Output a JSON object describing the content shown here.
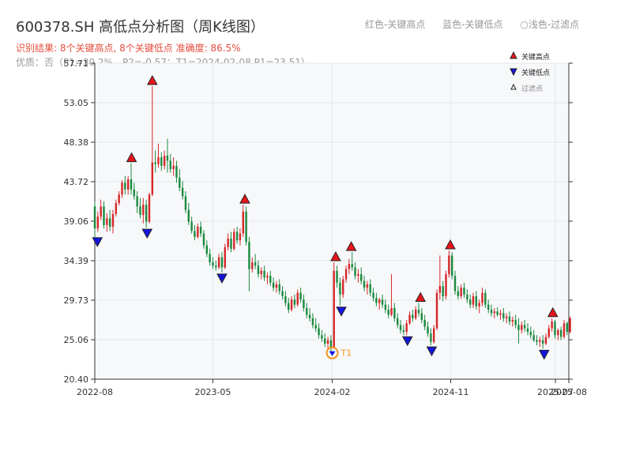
{
  "title": "600378.SH 高低点分析图（周K线图）",
  "subtitle": "识别结果: 8个关键高点, 8个关键低点   准确度: 86.5%",
  "info": "优质：否（P1=30.2%，P2=-0.57；T1=2024-02-08 P1=23.51）",
  "legend_top": [
    "红色-关键高点",
    "蓝色-关键低点",
    "○浅色-过滤点"
  ],
  "colors": {
    "up": "#d62728",
    "down": "#1a8a3e",
    "high_marker": "#e8141a",
    "low_marker": "#1414e0",
    "t1_marker": "#f0921e",
    "plot_bg": "#f7f8fa",
    "grid": "#e3e6ea"
  },
  "chart_data": {
    "type": "candlestick",
    "frequency": "weekly",
    "x_start": "2022-08",
    "x_end": "2025-08",
    "xticks": [
      "2022-08",
      "2023-05",
      "2024-02",
      "2024-11",
      "2025-07",
      "2025-08"
    ],
    "ylim": [
      20.4,
      57.71
    ],
    "yticks": [
      20.4,
      25.06,
      29.73,
      34.39,
      39.06,
      43.72,
      48.38,
      53.05,
      57.71
    ],
    "grid": true,
    "legend": {
      "position": "top-right",
      "items": [
        {
          "label": "关键高点",
          "marker": "triangle-up",
          "color": "red"
        },
        {
          "label": "关键低点",
          "marker": "triangle-down",
          "color": "blue"
        },
        {
          "label": "过滤点",
          "marker": "triangle-up-hollow",
          "color": "light"
        }
      ]
    },
    "key_highs": [
      {
        "date": "2022-10-25",
        "price": 45.9
      },
      {
        "date": "2022-12-12",
        "price": 55.0
      },
      {
        "date": "2023-07-14",
        "price": 41.0
      },
      {
        "date": "2024-02-09",
        "price": 34.2
      },
      {
        "date": "2024-03-16",
        "price": 35.4
      },
      {
        "date": "2024-08-23",
        "price": 29.4
      },
      {
        "date": "2024-10-31",
        "price": 35.6
      },
      {
        "date": "2025-06-25",
        "price": 27.6
      }
    ],
    "key_lows": [
      {
        "date": "2022-08-07",
        "price": 37.3
      },
      {
        "date": "2022-11-30",
        "price": 38.3
      },
      {
        "date": "2023-05-22",
        "price": 33.0
      },
      {
        "date": "2024-02-22",
        "price": 29.1
      },
      {
        "date": "2024-07-24",
        "price": 25.6
      },
      {
        "date": "2024-09-18",
        "price": 24.4
      },
      {
        "date": "2025-06-05",
        "price": 24.0
      }
    ],
    "annotations": [
      {
        "label": "T1",
        "date": "2024-02-01",
        "price": 23.51
      }
    ],
    "ohlc": [
      [
        "2022-08-01",
        40.8,
        41.4,
        37.0,
        38.2
      ],
      [
        "2022-08-08",
        38.2,
        40.2,
        37.8,
        39.6
      ],
      [
        "2022-08-15",
        39.6,
        41.6,
        39.2,
        40.8
      ],
      [
        "2022-08-22",
        40.8,
        41.4,
        38.2,
        38.6
      ],
      [
        "2022-08-29",
        38.6,
        40.0,
        37.8,
        39.4
      ],
      [
        "2022-09-05",
        39.4,
        40.4,
        37.9,
        38.4
      ],
      [
        "2022-09-12",
        38.4,
        40.4,
        37.6,
        39.9
      ],
      [
        "2022-09-19",
        39.9,
        41.6,
        39.6,
        41.2
      ],
      [
        "2022-09-26",
        41.2,
        42.6,
        40.9,
        42.2
      ],
      [
        "2022-10-03",
        42.2,
        43.9,
        41.8,
        43.6
      ],
      [
        "2022-10-10",
        43.6,
        44.4,
        42.2,
        42.8
      ],
      [
        "2022-10-17",
        42.8,
        44.4,
        42.2,
        44.0
      ],
      [
        "2022-10-24",
        44.0,
        45.9,
        42.2,
        42.8
      ],
      [
        "2022-10-31",
        42.8,
        43.6,
        41.6,
        42.0
      ],
      [
        "2022-11-07",
        42.0,
        42.6,
        40.0,
        40.8
      ],
      [
        "2022-11-14",
        40.8,
        41.8,
        39.4,
        39.8
      ],
      [
        "2022-11-21",
        39.8,
        41.8,
        38.8,
        41.0
      ],
      [
        "2022-11-28",
        41.0,
        41.6,
        38.3,
        39.0
      ],
      [
        "2022-12-05",
        39.0,
        42.4,
        38.8,
        42.2
      ],
      [
        "2022-12-12",
        42.2,
        55.0,
        42.0,
        46.0
      ],
      [
        "2022-12-19",
        46.0,
        47.4,
        44.8,
        45.8
      ],
      [
        "2022-12-26",
        45.8,
        48.2,
        45.4,
        46.6
      ],
      [
        "2023-01-02",
        46.6,
        47.2,
        45.0,
        45.6
      ],
      [
        "2023-01-09",
        45.6,
        47.4,
        45.2,
        46.8
      ],
      [
        "2023-01-16",
        46.8,
        48.8,
        44.8,
        46.2
      ],
      [
        "2023-01-23",
        46.2,
        47.0,
        44.8,
        45.2
      ],
      [
        "2023-01-30",
        45.2,
        46.6,
        44.4,
        45.6
      ],
      [
        "2023-02-06",
        45.6,
        46.2,
        43.6,
        44.2
      ],
      [
        "2023-02-13",
        44.2,
        45.2,
        42.6,
        43.0
      ],
      [
        "2023-02-20",
        43.0,
        43.8,
        41.6,
        42.0
      ],
      [
        "2023-02-27",
        42.0,
        42.6,
        40.0,
        40.4
      ],
      [
        "2023-03-06",
        40.4,
        41.2,
        38.6,
        39.0
      ],
      [
        "2023-03-13",
        39.0,
        39.6,
        37.6,
        37.9
      ],
      [
        "2023-03-20",
        37.9,
        38.6,
        36.8,
        37.2
      ],
      [
        "2023-03-27",
        37.2,
        38.8,
        37.0,
        38.4
      ],
      [
        "2023-04-03",
        38.4,
        39.0,
        37.2,
        37.6
      ],
      [
        "2023-04-10",
        37.6,
        38.0,
        35.8,
        36.2
      ],
      [
        "2023-04-17",
        36.2,
        36.8,
        34.8,
        35.2
      ],
      [
        "2023-04-24",
        35.2,
        35.8,
        33.8,
        34.2
      ],
      [
        "2023-05-01",
        34.2,
        34.8,
        33.4,
        33.8
      ],
      [
        "2023-05-08",
        33.8,
        34.4,
        33.2,
        33.6
      ],
      [
        "2023-05-15",
        33.6,
        35.2,
        33.4,
        34.8
      ],
      [
        "2023-05-22",
        34.8,
        35.4,
        33.0,
        33.6
      ],
      [
        "2023-05-29",
        33.6,
        36.4,
        33.4,
        36.0
      ],
      [
        "2023-06-05",
        36.0,
        37.6,
        35.6,
        37.0
      ],
      [
        "2023-06-12",
        37.0,
        37.8,
        35.4,
        35.8
      ],
      [
        "2023-06-19",
        35.8,
        38.2,
        35.6,
        37.8
      ],
      [
        "2023-06-26",
        37.8,
        38.4,
        36.4,
        36.8
      ],
      [
        "2023-07-03",
        36.8,
        38.2,
        36.2,
        37.6
      ],
      [
        "2023-07-10",
        37.6,
        41.0,
        37.2,
        40.2
      ],
      [
        "2023-07-17",
        40.2,
        40.8,
        36.2,
        36.6
      ],
      [
        "2023-07-24",
        36.6,
        37.2,
        30.8,
        33.4
      ],
      [
        "2023-07-31",
        33.4,
        34.8,
        33.0,
        34.2
      ],
      [
        "2023-08-07",
        34.2,
        35.2,
        33.4,
        33.8
      ],
      [
        "2023-08-14",
        33.8,
        34.4,
        32.4,
        32.8
      ],
      [
        "2023-08-21",
        32.8,
        33.6,
        32.2,
        33.2
      ],
      [
        "2023-08-28",
        33.2,
        33.8,
        32.0,
        32.4
      ],
      [
        "2023-09-04",
        32.4,
        33.0,
        31.6,
        32.6
      ],
      [
        "2023-09-11",
        32.6,
        33.2,
        31.4,
        31.8
      ],
      [
        "2023-09-18",
        31.8,
        32.4,
        30.8,
        31.2
      ],
      [
        "2023-09-25",
        31.2,
        32.0,
        30.6,
        31.6
      ],
      [
        "2023-10-02",
        31.6,
        32.2,
        30.4,
        30.8
      ],
      [
        "2023-10-09",
        30.8,
        31.4,
        29.8,
        30.2
      ],
      [
        "2023-10-16",
        30.2,
        30.8,
        29.0,
        29.4
      ],
      [
        "2023-10-23",
        29.4,
        30.0,
        28.2,
        28.6
      ],
      [
        "2023-10-30",
        28.6,
        30.2,
        28.4,
        29.8
      ],
      [
        "2023-11-06",
        29.8,
        30.4,
        28.8,
        29.2
      ],
      [
        "2023-11-13",
        29.2,
        31.0,
        29.0,
        30.6
      ],
      [
        "2023-11-20",
        30.6,
        31.2,
        29.4,
        29.8
      ],
      [
        "2023-11-27",
        29.8,
        30.4,
        28.4,
        28.8
      ],
      [
        "2023-12-04",
        28.8,
        29.4,
        27.6,
        28.0
      ],
      [
        "2023-12-11",
        28.0,
        28.8,
        27.2,
        27.6
      ],
      [
        "2023-12-18",
        27.6,
        28.2,
        26.4,
        26.8
      ],
      [
        "2023-12-25",
        26.8,
        27.6,
        26.0,
        26.4
      ],
      [
        "2024-01-01",
        26.4,
        27.0,
        25.2,
        25.6
      ],
      [
        "2024-01-08",
        25.6,
        26.2,
        24.8,
        25.2
      ],
      [
        "2024-01-15",
        25.2,
        25.8,
        24.2,
        24.6
      ],
      [
        "2024-01-22",
        24.6,
        25.4,
        24.0,
        25.0
      ],
      [
        "2024-01-29",
        25.0,
        25.6,
        23.51,
        24.2
      ],
      [
        "2024-02-05",
        24.2,
        34.2,
        24.0,
        33.2
      ],
      [
        "2024-02-12",
        33.2,
        33.8,
        31.2,
        31.8
      ],
      [
        "2024-02-19",
        31.8,
        32.4,
        29.1,
        30.4
      ],
      [
        "2024-02-26",
        30.4,
        32.6,
        30.0,
        32.2
      ],
      [
        "2024-03-04",
        32.2,
        33.8,
        31.8,
        33.4
      ],
      [
        "2024-03-11",
        33.4,
        34.6,
        32.8,
        34.0
      ],
      [
        "2024-03-18",
        34.0,
        35.4,
        33.2,
        33.6
      ],
      [
        "2024-03-25",
        33.6,
        34.2,
        32.2,
        32.6
      ],
      [
        "2024-04-01",
        32.6,
        33.4,
        31.8,
        32.8
      ],
      [
        "2024-04-08",
        32.8,
        33.6,
        31.6,
        32.0
      ],
      [
        "2024-04-15",
        32.0,
        32.6,
        30.8,
        31.2
      ],
      [
        "2024-04-22",
        31.2,
        32.0,
        30.4,
        31.6
      ],
      [
        "2024-04-29",
        31.6,
        32.2,
        30.2,
        30.6
      ],
      [
        "2024-05-06",
        30.6,
        31.2,
        29.6,
        30.0
      ],
      [
        "2024-05-13",
        30.0,
        30.6,
        29.0,
        29.4
      ],
      [
        "2024-05-20",
        29.4,
        30.0,
        28.6,
        29.8
      ],
      [
        "2024-05-27",
        29.8,
        30.4,
        28.8,
        29.2
      ],
      [
        "2024-06-03",
        29.2,
        29.8,
        28.2,
        28.6
      ],
      [
        "2024-06-10",
        28.6,
        29.2,
        27.6,
        28.0
      ],
      [
        "2024-06-17",
        28.0,
        32.8,
        27.8,
        28.8
      ],
      [
        "2024-06-24",
        28.8,
        29.4,
        27.2,
        27.6
      ],
      [
        "2024-07-01",
        27.6,
        28.2,
        26.4,
        26.8
      ],
      [
        "2024-07-08",
        26.8,
        27.4,
        25.8,
        26.2
      ],
      [
        "2024-07-15",
        26.2,
        26.8,
        25.6,
        26.0
      ],
      [
        "2024-07-22",
        26.0,
        27.4,
        25.6,
        27.0
      ],
      [
        "2024-07-29",
        27.0,
        28.4,
        26.8,
        28.0
      ],
      [
        "2024-08-05",
        28.0,
        28.6,
        27.2,
        27.6
      ],
      [
        "2024-08-12",
        27.6,
        29.0,
        27.4,
        28.6
      ],
      [
        "2024-08-19",
        28.6,
        29.4,
        27.8,
        28.2
      ],
      [
        "2024-08-26",
        28.2,
        28.8,
        27.0,
        27.4
      ],
      [
        "2024-09-02",
        27.4,
        28.0,
        26.2,
        26.6
      ],
      [
        "2024-09-09",
        26.6,
        27.2,
        25.4,
        25.8
      ],
      [
        "2024-09-16",
        25.8,
        26.4,
        24.4,
        24.8
      ],
      [
        "2024-09-23",
        24.8,
        26.8,
        24.6,
        26.4
      ],
      [
        "2024-09-30",
        26.4,
        31.0,
        26.2,
        30.6
      ],
      [
        "2024-10-07",
        30.6,
        35.0,
        29.8,
        31.4
      ],
      [
        "2024-10-14",
        31.4,
        32.0,
        29.6,
        30.2
      ],
      [
        "2024-10-21",
        30.2,
        33.2,
        29.8,
        32.8
      ],
      [
        "2024-10-28",
        32.8,
        35.6,
        32.4,
        35.0
      ],
      [
        "2024-11-04",
        35.0,
        35.4,
        32.2,
        32.6
      ],
      [
        "2024-11-11",
        32.6,
        33.2,
        30.4,
        30.8
      ],
      [
        "2024-11-18",
        30.8,
        31.4,
        29.8,
        30.2
      ],
      [
        "2024-11-25",
        30.2,
        31.6,
        29.9,
        31.2
      ],
      [
        "2024-12-02",
        31.2,
        31.8,
        30.0,
        30.4
      ],
      [
        "2024-12-09",
        30.4,
        31.0,
        29.4,
        29.8
      ],
      [
        "2024-12-16",
        29.8,
        30.4,
        28.8,
        29.2
      ],
      [
        "2024-12-23",
        29.2,
        30.6,
        28.8,
        30.2
      ],
      [
        "2024-12-30",
        30.2,
        30.8,
        28.6,
        29.0
      ],
      [
        "2025-01-06",
        29.0,
        29.8,
        28.2,
        29.4
      ],
      [
        "2025-01-13",
        29.4,
        31.2,
        29.0,
        30.6
      ],
      [
        "2025-01-20",
        30.6,
        31.0,
        28.8,
        29.2
      ],
      [
        "2025-01-27",
        29.2,
        29.8,
        28.2,
        28.6
      ],
      [
        "2025-02-03",
        28.6,
        29.2,
        27.8,
        28.2
      ],
      [
        "2025-02-10",
        28.2,
        28.8,
        27.6,
        28.4
      ],
      [
        "2025-02-17",
        28.4,
        28.9,
        27.8,
        28.0
      ],
      [
        "2025-02-24",
        28.0,
        28.6,
        27.4,
        28.2
      ],
      [
        "2025-03-03",
        28.2,
        28.8,
        27.2,
        27.6
      ],
      [
        "2025-03-10",
        27.6,
        28.2,
        27.0,
        27.8
      ],
      [
        "2025-03-17",
        27.8,
        28.4,
        26.8,
        27.2
      ],
      [
        "2025-03-24",
        27.2,
        27.8,
        26.6,
        27.4
      ],
      [
        "2025-03-31",
        27.4,
        28.0,
        26.4,
        26.8
      ],
      [
        "2025-04-07",
        26.8,
        27.6,
        24.6,
        26.2
      ],
      [
        "2025-04-14",
        26.2,
        27.2,
        25.8,
        26.8
      ],
      [
        "2025-04-21",
        26.8,
        27.4,
        26.0,
        26.4
      ],
      [
        "2025-04-28",
        26.4,
        27.0,
        25.6,
        26.0
      ],
      [
        "2025-05-05",
        26.0,
        26.6,
        25.2,
        25.6
      ],
      [
        "2025-05-12",
        25.6,
        26.2,
        24.8,
        25.0
      ],
      [
        "2025-05-19",
        25.0,
        25.6,
        24.4,
        24.8
      ],
      [
        "2025-05-26",
        24.8,
        25.4,
        24.2,
        25.0
      ],
      [
        "2025-06-02",
        25.0,
        25.6,
        24.0,
        24.6
      ],
      [
        "2025-06-09",
        24.6,
        25.8,
        24.4,
        25.4
      ],
      [
        "2025-06-16",
        25.4,
        26.8,
        25.2,
        26.4
      ],
      [
        "2025-06-23",
        26.4,
        27.6,
        26.0,
        27.2
      ],
      [
        "2025-06-30",
        27.2,
        27.4,
        25.2,
        25.6
      ],
      [
        "2025-07-07",
        25.6,
        26.4,
        25.0,
        26.2
      ],
      [
        "2025-07-14",
        26.2,
        26.6,
        25.0,
        25.4
      ],
      [
        "2025-07-21",
        25.4,
        27.4,
        25.2,
        27.0
      ],
      [
        "2025-07-28",
        27.0,
        27.2,
        25.6,
        26.0
      ],
      [
        "2025-08-04",
        26.0,
        27.8,
        25.8,
        27.6
      ]
    ]
  }
}
